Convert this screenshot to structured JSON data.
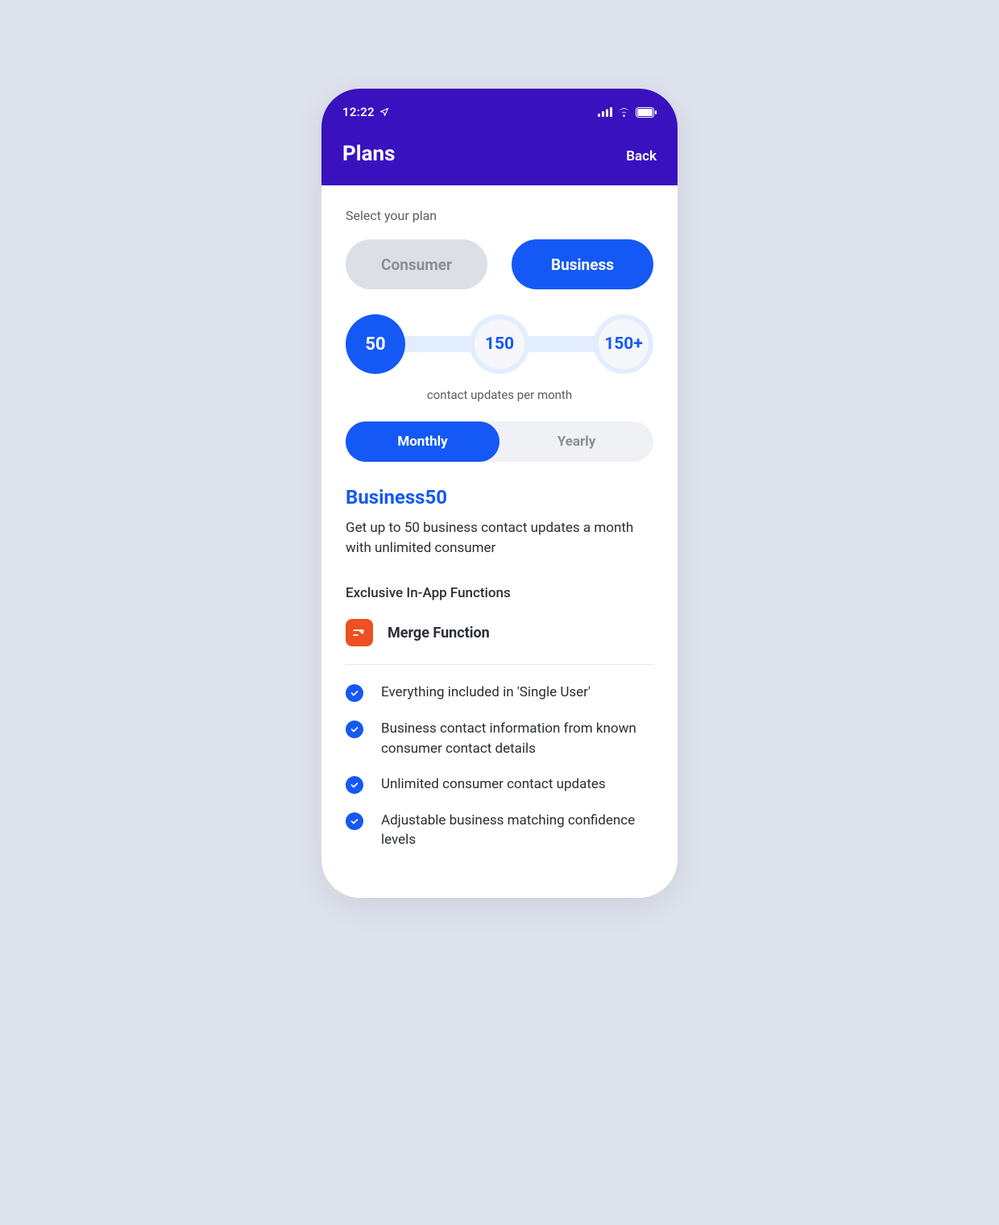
{
  "status": {
    "time": "12:22"
  },
  "header": {
    "title": "Plans",
    "back": "Back"
  },
  "select_label": "Select your plan",
  "plan_types": {
    "consumer": "Consumer",
    "business": "Business",
    "selected": "business"
  },
  "tiers": {
    "options": [
      "50",
      "150",
      "150+"
    ],
    "selected_index": 0,
    "subtitle": "contact updates per month"
  },
  "billing": {
    "monthly": "Monthly",
    "yearly": "Yearly",
    "selected": "monthly"
  },
  "plan": {
    "name": "Business50",
    "description": "Get up to 50 business contact updates a month with unlimited consumer",
    "functions_label": "Exclusive In-App Functions",
    "function_title": "Merge Function",
    "features": [
      "Everything included in 'Single User'",
      "Business contact information from known consumer contact details",
      "Unlimited consumer contact updates",
      "Adjustable business matching confidence levels"
    ]
  }
}
